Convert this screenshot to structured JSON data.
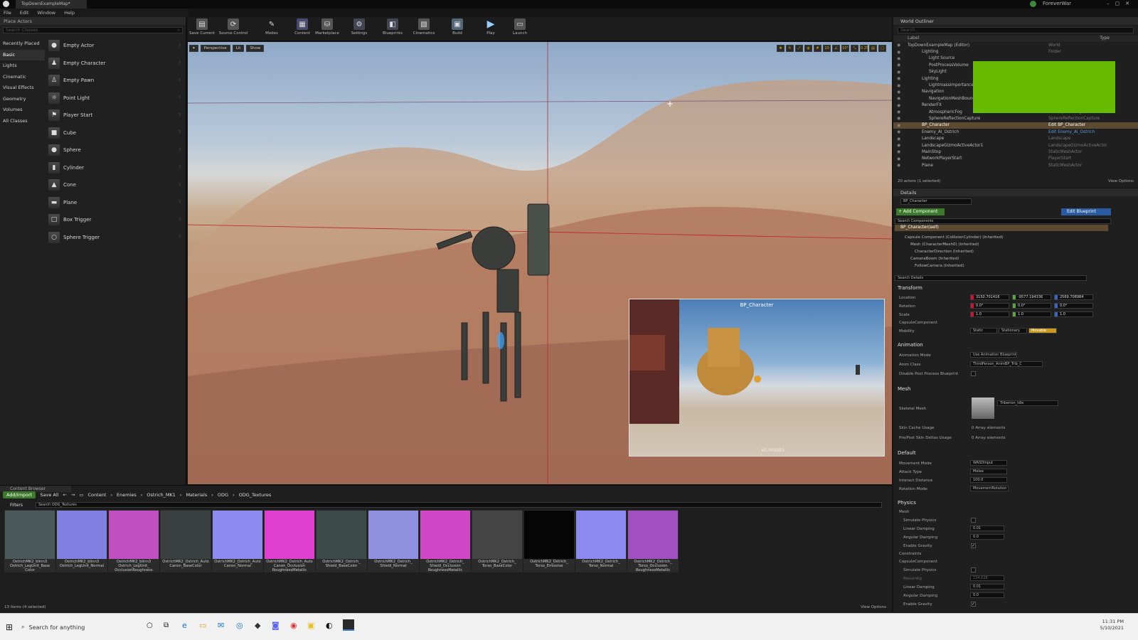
{
  "window": {
    "tab": "TopDownExampleMap*",
    "user": "ForeverWar"
  },
  "menu": [
    "File",
    "Edit",
    "Window",
    "Help"
  ],
  "place_actors": {
    "title": "Place Actors",
    "search_placeholder": "Search Classes",
    "categories": [
      "Recently Placed",
      "Basic",
      "Lights",
      "Cinematic",
      "Visual Effects",
      "Geometry",
      "Volumes",
      "All Classes"
    ],
    "items": [
      "Empty Actor",
      "Empty Character",
      "Empty Pawn",
      "Point Light",
      "Player Start",
      "Cube",
      "Sphere",
      "Cylinder",
      "Cone",
      "Plane",
      "Box Trigger",
      "Sphere Trigger"
    ]
  },
  "toolbar": [
    "Save Current",
    "Source Control",
    "Modes",
    "Content",
    "Marketplace",
    "Settings",
    "Blueprints",
    "Cinematics",
    "Build",
    "Play",
    "Launch"
  ],
  "viewport": {
    "perspective": "Perspective",
    "lit": "Lit",
    "show": "Show",
    "snap1": "10",
    "snap2": "10°",
    "snap3": "0.25"
  },
  "pip": {
    "title": "BP_Character",
    "fps": "60.000003"
  },
  "outliner": {
    "title": "World Outliner",
    "search_placeholder": "Search...",
    "col_label": "Label",
    "col_type": "Type",
    "rows": [
      {
        "label": "TopDownExampleMap (Editor)",
        "type": "World"
      },
      {
        "label": "Lighting",
        "type": "Folder"
      },
      {
        "label": "Light Source",
        "type": ""
      },
      {
        "label": "PostProcessVolume",
        "type": ""
      },
      {
        "label": "SkyLight",
        "type": ""
      },
      {
        "label": "Lighting",
        "type": ""
      },
      {
        "label": "LightmassImportanceV",
        "type": ""
      },
      {
        "label": "Navigation",
        "type": ""
      },
      {
        "label": "NavigationMeshBoundsV",
        "type": ""
      },
      {
        "label": "RenderFX",
        "type": ""
      },
      {
        "label": "AtmosphericFog",
        "type": "AtmosphericFog"
      },
      {
        "label": "SphereReflectionCapture",
        "type": "SphereReflectionCapture"
      },
      {
        "label": "BP_Character",
        "type": "Edit BP_Character"
      },
      {
        "label": "Enemy_AI_Ostrich",
        "type": "Edit Enemy_AI_Ostrich"
      },
      {
        "label": "Landscape",
        "type": "Landscape"
      },
      {
        "label": "LandscapeGizmoActiveActor1",
        "type": "LandscapeGizmoActiveActor"
      },
      {
        "label": "MainStop",
        "type": "StaticMeshActor"
      },
      {
        "label": "NetworkPlayerStart",
        "type": "PlayerStart"
      },
      {
        "label": "Plane",
        "type": "StaticMeshActor"
      }
    ],
    "footer": "20 actors (1 selected)",
    "view_options": "View Options"
  },
  "details": {
    "title": "Details",
    "name": "BP_Character",
    "add_component": "+ Add Component",
    "edit_blueprint": "Edit Blueprint",
    "search_components": "Search Components",
    "components": [
      "BP_Character(self)",
      "Capsule Component (CollisionCylinder) (Inherited)",
      "Mesh (CharacterMesh0) (Inherited)",
      "CharacterDirection (Inherited)",
      "CameraBoom (Inherited)",
      "FollowCamera (Inherited)"
    ],
    "search_details": "Search Details",
    "transform": {
      "title": "Transform",
      "location": "Location",
      "rotation": "Rotation",
      "scale": "Scale",
      "loc": [
        "3150.701416",
        "-9577.194336",
        "2569.708984"
      ],
      "rot": [
        "0.0°",
        "0.0°",
        "0.0°"
      ],
      "scl": [
        "1.0",
        "1.0",
        "1.0"
      ],
      "capsule": "CapsuleComponent",
      "mobility": "Mobility",
      "static": "Static",
      "stationary": "Stationary",
      "movable": "Movable"
    },
    "animation": {
      "title": "Animation",
      "mode_label": "Animation Mode",
      "mode": "Use Animation Blueprint",
      "class_label": "Anim Class",
      "class": "ThirdPerson_AnimBP_Trib_C",
      "disable_pp": "Disable Post Process Blueprint"
    },
    "mesh": {
      "title": "Mesh",
      "skeletal": "Skeletal Mesh",
      "mesh_name": "Triberion_Idle",
      "skin_cache": "Skin Cache Usage",
      "skin_val": "0 Array elements",
      "deltas": "Pre/Post Skin Deltas Usage",
      "deltas_val": "0 Array elements"
    },
    "default": {
      "title": "Default",
      "movement_label": "Movement Mode",
      "movement": "WASDInput",
      "attack_label": "Attack Type",
      "attack": "Melee",
      "interact_label": "Interact Distance",
      "interact": "100.0",
      "rotation_label": "Rotation Mode",
      "rotation": "MovementRotation"
    },
    "physics": {
      "title": "Physics",
      "mesh": "Mesh",
      "sim": "Simulate Physics",
      "lin": "Linear Damping",
      "lin_v": "0.01",
      "ang": "Angular Damping",
      "ang_v": "0.0",
      "grav": "Enable Gravity",
      "constraints": "Constraints",
      "capsule": "CapsuleComponent",
      "sim2": "Simulate Physics",
      "mass": "MassInKg",
      "mass_v": "134.628",
      "lin2": "Linear Damping",
      "lin2_v": "0.01",
      "ang2": "Angular Damping",
      "ang2_v": "0.0",
      "grav2": "Enable Gravity"
    }
  },
  "content_browser": {
    "title": "Content Browser",
    "add": "Add/Import",
    "save_all": "Save All",
    "path": [
      "Content",
      "Enemies",
      "Ostrich_MK1",
      "Materials",
      "ODG",
      "ODG_Textures"
    ],
    "filters": "Filters",
    "search_placeholder": "Search ODG_Textures",
    "assets": [
      {
        "name": "OstrichMK2_blinn3 Ostrich_LegUnit_Base Color",
        "color": "#4a5a5a"
      },
      {
        "name": "OstrichMK2_blinn3 Ostrich_LegUnit_Normal",
        "color": "#8080e0"
      },
      {
        "name": "OstrichMK2_blinn3 Ostrich_LegUnit_ OcclusionRoughness",
        "color": "#c050c0"
      },
      {
        "name": "OstrichMK2_Ostrich_Auto Canon_BaseColor",
        "color": "#3a3f3f"
      },
      {
        "name": "OstrichMK2_Ostrich_Auto Canon_Normal",
        "color": "#8c8cf0"
      },
      {
        "name": "OstrichMK2_Ostrich_Auto Canon_Occlusion RoughnessMetallic",
        "color": "#e040d0"
      },
      {
        "name": "OstrichMK2_Ostrich_ Shield_BaseColor",
        "color": "#3d4a4a"
      },
      {
        "name": "OstrichMK2_Ostrich_ Shield_Normal",
        "color": "#9090e0"
      },
      {
        "name": "OstrichMK2_Ostrich_ Shield_Occlusion RoughnessMetallic",
        "color": "#d048c8"
      },
      {
        "name": "OstrichMK2_Ostrich_ Torso_BaseColor",
        "color": "#444"
      },
      {
        "name": "OstrichMK2_Ostrich_ Torso_Emissive",
        "color": "#050505"
      },
      {
        "name": "OstrichMK2_Ostrich_ Torso_Normal",
        "color": "#8a8af0"
      },
      {
        "name": "OstrichMK2_Ostrich_ Torso_Occlusion RoughnessMetallic",
        "color": "#a050c0"
      }
    ],
    "footer": "13 items (4 selected)",
    "view_options": "View Options"
  },
  "taskbar": {
    "search": "Search for anything",
    "time": "11:31 PM",
    "date": "5/10/2021"
  }
}
